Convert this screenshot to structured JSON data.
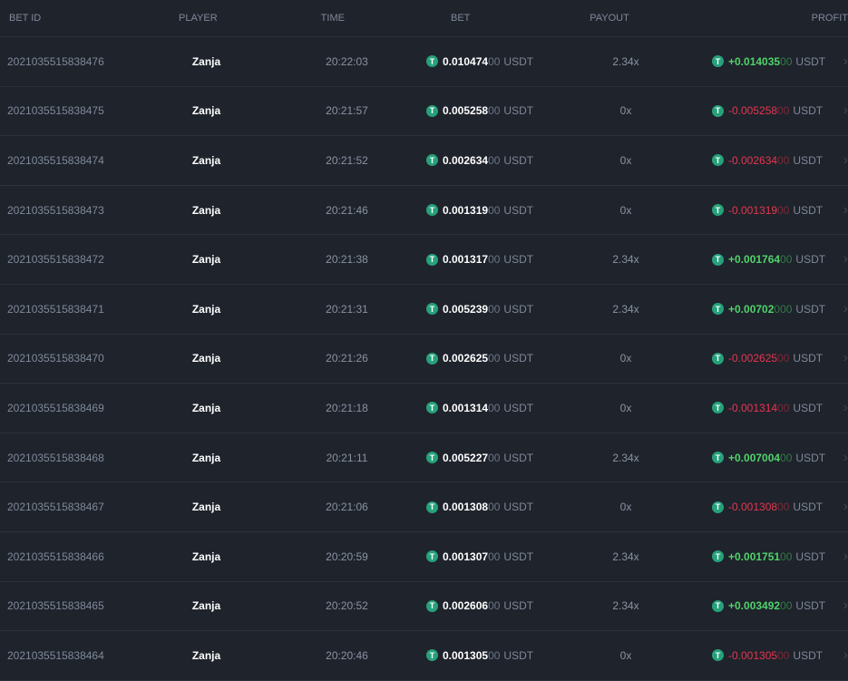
{
  "header": {
    "bet_id": "BET ID",
    "player": "PLAYER",
    "time": "TIME",
    "bet": "BET",
    "payout": "PAYOUT",
    "profit": "PROFIT"
  },
  "colors": {
    "background": "#1f232c",
    "positive": "#4fd36b",
    "negative": "#e6364f",
    "coin": "#26a17b"
  },
  "currency_icon": "tether-icon",
  "rows": [
    {
      "id": "2021035515838476",
      "player": "Zanja",
      "time": "20:22:03",
      "bet": "0.010474",
      "bet_trail": "00",
      "currency": "USDT",
      "payout": "2.34x",
      "profit": "+0.014035",
      "profit_trail": "00",
      "win": true
    },
    {
      "id": "2021035515838475",
      "player": "Zanja",
      "time": "20:21:57",
      "bet": "0.005258",
      "bet_trail": "00",
      "currency": "USDT",
      "payout": "0x",
      "profit": "-0.005258",
      "profit_trail": "00",
      "win": false
    },
    {
      "id": "2021035515838474",
      "player": "Zanja",
      "time": "20:21:52",
      "bet": "0.002634",
      "bet_trail": "00",
      "currency": "USDT",
      "payout": "0x",
      "profit": "-0.002634",
      "profit_trail": "00",
      "win": false
    },
    {
      "id": "2021035515838473",
      "player": "Zanja",
      "time": "20:21:46",
      "bet": "0.001319",
      "bet_trail": "00",
      "currency": "USDT",
      "payout": "0x",
      "profit": "-0.001319",
      "profit_trail": "00",
      "win": false
    },
    {
      "id": "2021035515838472",
      "player": "Zanja",
      "time": "20:21:38",
      "bet": "0.001317",
      "bet_trail": "00",
      "currency": "USDT",
      "payout": "2.34x",
      "profit": "+0.001764",
      "profit_trail": "00",
      "win": true
    },
    {
      "id": "2021035515838471",
      "player": "Zanja",
      "time": "20:21:31",
      "bet": "0.005239",
      "bet_trail": "00",
      "currency": "USDT",
      "payout": "2.34x",
      "profit": "+0.00702",
      "profit_trail": "000",
      "win": true
    },
    {
      "id": "2021035515838470",
      "player": "Zanja",
      "time": "20:21:26",
      "bet": "0.002625",
      "bet_trail": "00",
      "currency": "USDT",
      "payout": "0x",
      "profit": "-0.002625",
      "profit_trail": "00",
      "win": false
    },
    {
      "id": "2021035515838469",
      "player": "Zanja",
      "time": "20:21:18",
      "bet": "0.001314",
      "bet_trail": "00",
      "currency": "USDT",
      "payout": "0x",
      "profit": "-0.001314",
      "profit_trail": "00",
      "win": false
    },
    {
      "id": "2021035515838468",
      "player": "Zanja",
      "time": "20:21:11",
      "bet": "0.005227",
      "bet_trail": "00",
      "currency": "USDT",
      "payout": "2.34x",
      "profit": "+0.007004",
      "profit_trail": "00",
      "win": true
    },
    {
      "id": "2021035515838467",
      "player": "Zanja",
      "time": "20:21:06",
      "bet": "0.001308",
      "bet_trail": "00",
      "currency": "USDT",
      "payout": "0x",
      "profit": "-0.001308",
      "profit_trail": "00",
      "win": false
    },
    {
      "id": "2021035515838466",
      "player": "Zanja",
      "time": "20:20:59",
      "bet": "0.001307",
      "bet_trail": "00",
      "currency": "USDT",
      "payout": "2.34x",
      "profit": "+0.001751",
      "profit_trail": "00",
      "win": true
    },
    {
      "id": "2021035515838465",
      "player": "Zanja",
      "time": "20:20:52",
      "bet": "0.002606",
      "bet_trail": "00",
      "currency": "USDT",
      "payout": "2.34x",
      "profit": "+0.003492",
      "profit_trail": "00",
      "win": true
    },
    {
      "id": "2021035515838464",
      "player": "Zanja",
      "time": "20:20:46",
      "bet": "0.001305",
      "bet_trail": "00",
      "currency": "USDT",
      "payout": "0x",
      "profit": "-0.001305",
      "profit_trail": "00",
      "win": false
    }
  ]
}
